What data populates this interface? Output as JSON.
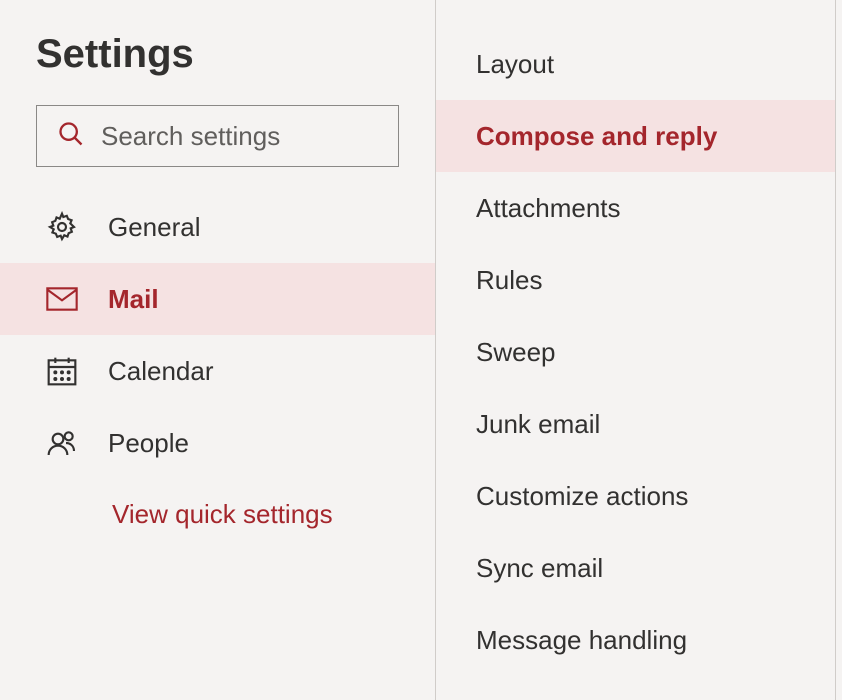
{
  "title": "Settings",
  "search": {
    "placeholder": "Search settings"
  },
  "sidebar": {
    "items": [
      {
        "label": "General"
      },
      {
        "label": "Mail"
      },
      {
        "label": "Calendar"
      },
      {
        "label": "People"
      }
    ],
    "quickSettings": "View quick settings"
  },
  "sub": {
    "items": [
      {
        "label": "Layout"
      },
      {
        "label": "Compose and reply"
      },
      {
        "label": "Attachments"
      },
      {
        "label": "Rules"
      },
      {
        "label": "Sweep"
      },
      {
        "label": "Junk email"
      },
      {
        "label": "Customize actions"
      },
      {
        "label": "Sync email"
      },
      {
        "label": "Message handling"
      }
    ]
  },
  "colors": {
    "accent": "#a4262c",
    "selectedBg": "#f5e2e2"
  }
}
